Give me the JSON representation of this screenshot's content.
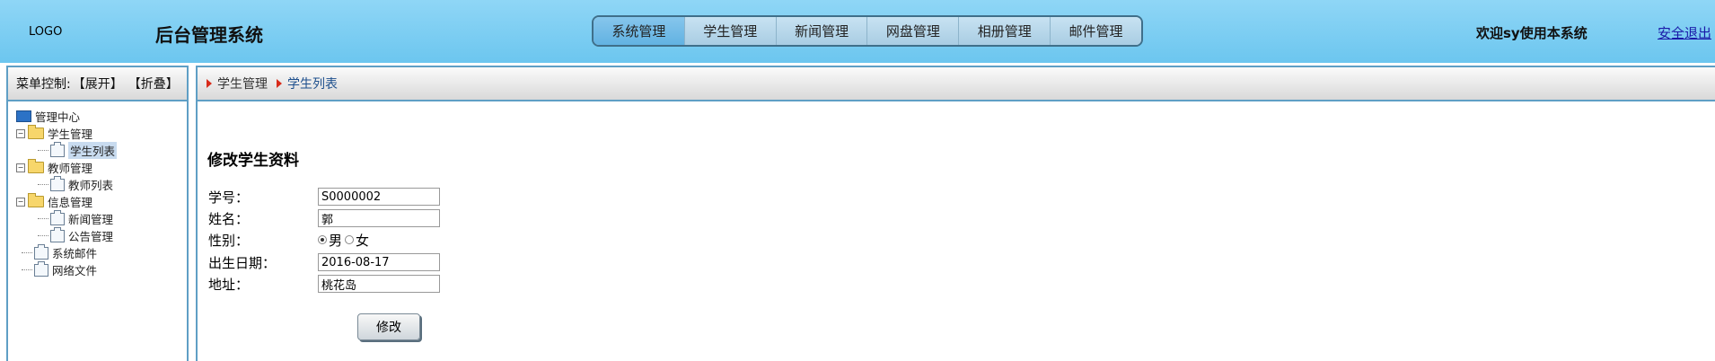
{
  "header": {
    "logo": "LOGO",
    "title": "后台管理系统",
    "nav": [
      "系统管理",
      "学生管理",
      "新闻管理",
      "网盘管理",
      "相册管理",
      "邮件管理"
    ],
    "welcome": "欢迎sy使用本系统",
    "logout": "安全退出"
  },
  "sidebar": {
    "control_label": "菜单控制:",
    "expand": "【展开】",
    "collapse": "【折叠】",
    "tree": {
      "root": "管理中心",
      "student_group": "学生管理",
      "student_list": "学生列表",
      "teacher_group": "教师管理",
      "teacher_list": "教师列表",
      "info_group": "信息管理",
      "news_mgmt": "新闻管理",
      "notice_mgmt": "公告管理",
      "system_mail": "系统邮件",
      "network_files": "网络文件"
    }
  },
  "breadcrumb": [
    "学生管理",
    "学生列表"
  ],
  "form": {
    "title": "修改学生资料",
    "student_id_label": "学号：",
    "student_id": "S0000002",
    "name_label": "姓名：",
    "name": "郭",
    "gender_label": "性别：",
    "gender_male": "男",
    "gender_female": "女",
    "birthdate_label": "出生日期：",
    "birthdate": "2016-08-17",
    "address_label": "地址：",
    "address": "桃花岛",
    "submit": "修改"
  }
}
